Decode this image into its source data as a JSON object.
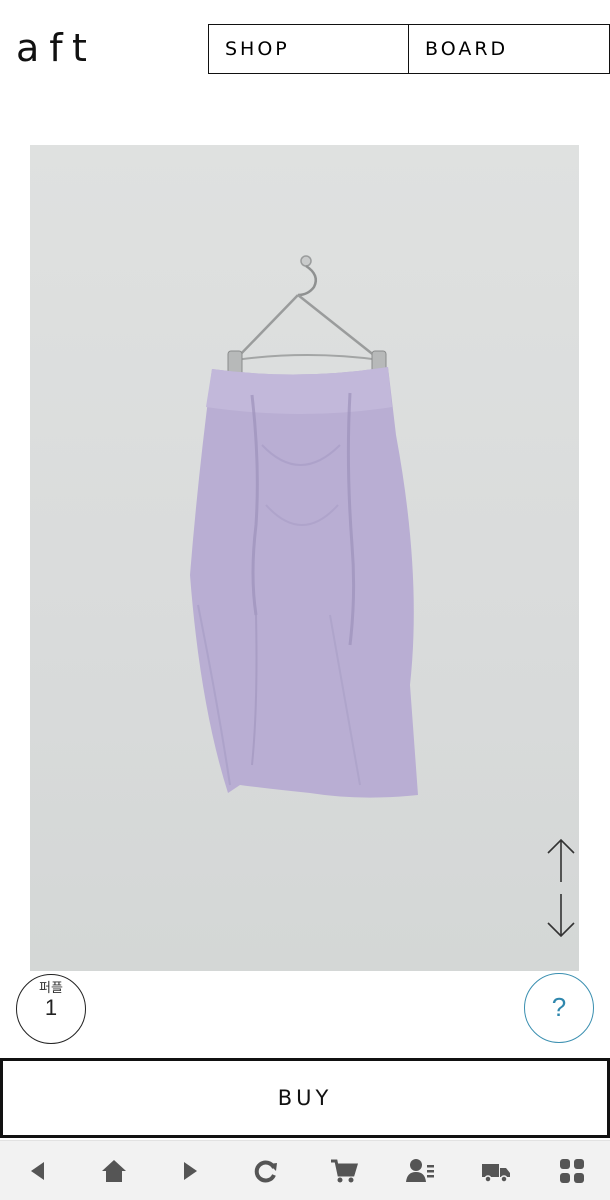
{
  "header": {
    "logo": "aft",
    "nav": [
      {
        "label": "SHOP"
      },
      {
        "label": "BOARD"
      }
    ]
  },
  "product": {
    "image": "lavender-ruched-skirt-on-hanger",
    "skirt_color": "#b9aed3",
    "wall_color": "#dcdedd"
  },
  "puffle": {
    "label": "퍼플",
    "count": "1"
  },
  "help": {
    "label": "?"
  },
  "buy": {
    "label": "BUY"
  },
  "toolbar": {
    "items": [
      "back-icon",
      "home-icon",
      "forward-icon",
      "refresh-icon",
      "cart-icon",
      "account-icon",
      "delivery-truck-icon",
      "menu-grid-icon"
    ],
    "icon_color": "#555555"
  }
}
